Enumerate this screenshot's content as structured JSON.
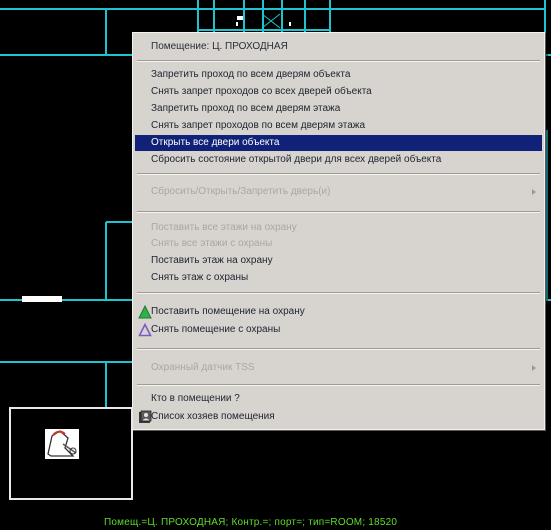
{
  "colors": {
    "background": "#000000",
    "plan_lines": "#1fc3cf",
    "menu_bg": "#d7d4cf",
    "highlight": "#0f2278",
    "status_text": "#5fdc2e",
    "arm_icon": "#2fb24a",
    "disarm_icon": "#7a5bc8"
  },
  "context_menu": {
    "header": "Помещение: Ц. ПРОХОДНАЯ",
    "doors_group": [
      "Запретить проход по всем дверям объекта",
      "Снять запрет проходов со всех дверей объекта",
      "Запретить проход по всем дверям этажа",
      "Снять запрет проходов по всем дверям этажа",
      "Открыть все двери объекта",
      "Сбросить состояние открытой двери  для всех дверей объекта"
    ],
    "highlighted_item": "Открыть все двери объекта",
    "door_submenu": "Сбросить/Открыть/Запретить дверь(и)",
    "floor_group": [
      "Поставить все этажи на охрану",
      "Снять все этажи с охраны",
      "Поставить этаж на охрану",
      "Снять этаж с охраны"
    ],
    "floor_group_disabled": [
      true,
      true,
      false,
      false
    ],
    "room_arm": "Поставить помещение на охрану",
    "room_arm_icon": "green-triangle-icon",
    "room_disarm": "Снять помещение с охраны",
    "room_disarm_icon": "purple-triangle-icon",
    "sensor_submenu": "Охранный датчик TSS",
    "who_in_room": "Кто в помещении ?",
    "owners_list": "Список хозяев помещения",
    "owners_icon": "owners-list-icon"
  },
  "minimap": {
    "icon": "doorway-icon"
  },
  "status_bar": {
    "text": "Помещ.=Ц. ПРОХОДНАЯ; Контр.=; порт=; тип=ROOM; 18520"
  }
}
